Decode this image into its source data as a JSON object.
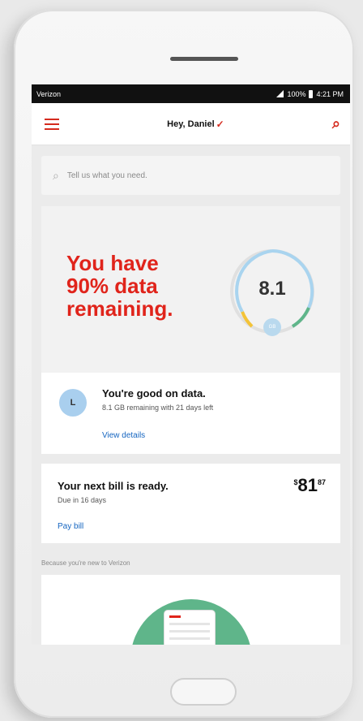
{
  "status_bar": {
    "carrier": "Verizon",
    "battery": "100%",
    "time": "4:21 PM"
  },
  "header": {
    "greeting": "Hey, Daniel",
    "check_mark": "✓"
  },
  "search": {
    "placeholder": "Tell us what you need."
  },
  "data_card": {
    "headline": "You have 90% data remaining.",
    "gauge_value": "8.1",
    "gauge_unit": "GB",
    "gauge_percent": 90,
    "avatar_initial": "L",
    "status_title": "You're good on data.",
    "status_detail": "8.1 GB remaining with 21 days left",
    "link": "View details"
  },
  "bill_card": {
    "title": "Your next bill is ready.",
    "due": "Due in 16 days",
    "amount_symbol": "$",
    "amount_dollars": "81",
    "amount_cents": "87",
    "link": "Pay bill"
  },
  "promo": {
    "label": "Because you're new to Verizon"
  },
  "colors": {
    "brand_red": "#e0241b",
    "link_blue": "#1565c0",
    "gauge_blue": "#a9d4ef",
    "gauge_green": "#5fb58a",
    "gauge_yellow": "#f3c338"
  }
}
